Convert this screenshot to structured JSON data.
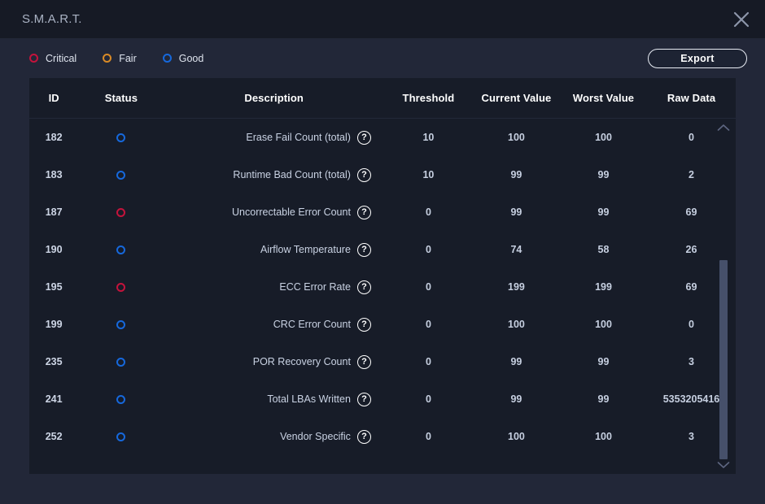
{
  "window": {
    "title": "S.M.A.R.T.",
    "close_icon": "close-icon"
  },
  "toolbar": {
    "legend": [
      {
        "label": "Critical",
        "color": "#c4133c"
      },
      {
        "label": "Fair",
        "color": "#d98a26"
      },
      {
        "label": "Good",
        "color": "#1668dc"
      }
    ],
    "export_label": "Export"
  },
  "table": {
    "columns": [
      "ID",
      "Status",
      "Description",
      "Threshold",
      "Current Value",
      "Worst Value",
      "Raw Data"
    ],
    "help_glyph": "?",
    "rows": [
      {
        "id": "182",
        "status": "Good",
        "status_color": "#1668dc",
        "description": "Erase Fail Count (total)",
        "threshold": "10",
        "current": "100",
        "worst": "100",
        "raw": "0"
      },
      {
        "id": "183",
        "status": "Good",
        "status_color": "#1668dc",
        "description": "Runtime Bad Count (total)",
        "threshold": "10",
        "current": "99",
        "worst": "99",
        "raw": "2"
      },
      {
        "id": "187",
        "status": "Critical",
        "status_color": "#c4133c",
        "description": "Uncorrectable Error Count",
        "threshold": "0",
        "current": "99",
        "worst": "99",
        "raw": "69"
      },
      {
        "id": "190",
        "status": "Good",
        "status_color": "#1668dc",
        "description": "Airflow Temperature",
        "threshold": "0",
        "current": "74",
        "worst": "58",
        "raw": "26"
      },
      {
        "id": "195",
        "status": "Critical",
        "status_color": "#c4133c",
        "description": "ECC Error Rate",
        "threshold": "0",
        "current": "199",
        "worst": "199",
        "raw": "69"
      },
      {
        "id": "199",
        "status": "Good",
        "status_color": "#1668dc",
        "description": "CRC Error Count",
        "threshold": "0",
        "current": "100",
        "worst": "100",
        "raw": "0"
      },
      {
        "id": "235",
        "status": "Good",
        "status_color": "#1668dc",
        "description": "POR Recovery Count",
        "threshold": "0",
        "current": "99",
        "worst": "99",
        "raw": "3"
      },
      {
        "id": "241",
        "status": "Good",
        "status_color": "#1668dc",
        "description": "Total LBAs Written",
        "threshold": "0",
        "current": "99",
        "worst": "99",
        "raw": "5353205416"
      },
      {
        "id": "252",
        "status": "Good",
        "status_color": "#1668dc",
        "description": "Vendor Specific",
        "threshold": "0",
        "current": "100",
        "worst": "100",
        "raw": "3"
      }
    ]
  },
  "scrollbar": {
    "up_icon": "chevron-up-icon",
    "down_icon": "chevron-down-icon"
  }
}
